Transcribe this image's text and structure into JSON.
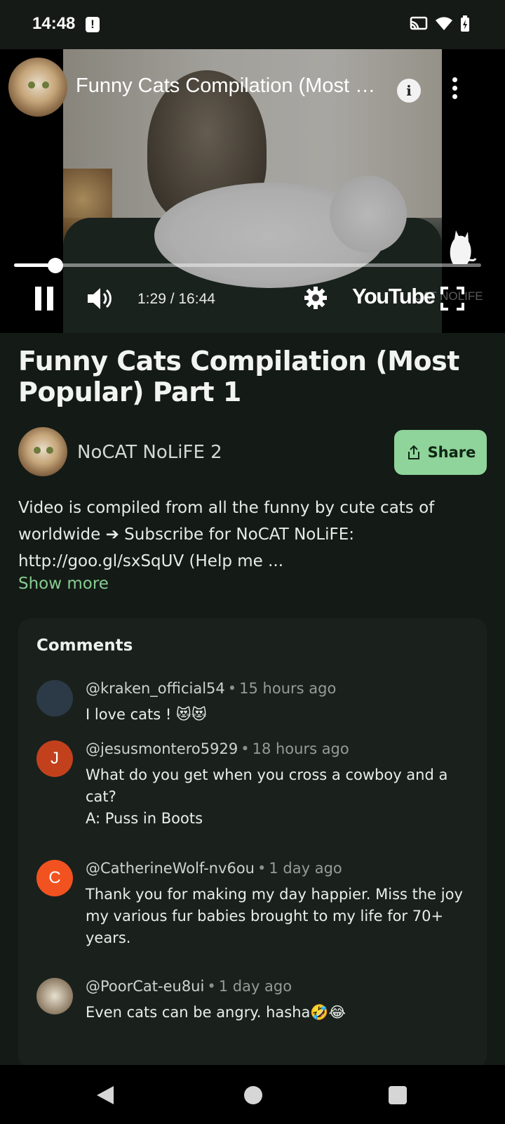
{
  "status_bar": {
    "time": "14:48",
    "alert_glyph": "!",
    "icons": [
      "cast-icon",
      "wifi-icon",
      "battery-charging-icon"
    ]
  },
  "player": {
    "title": "Funny Cats Compilation (Most Popular) Part 1",
    "info_glyph": "i",
    "time_readout": "1:29 / 16:44",
    "progress_fraction": 0.089,
    "logo_text": "YouTube",
    "watermark_text": "CAT NOLIFE"
  },
  "video": {
    "title": "Funny Cats Compilation (Most Popular) Part 1",
    "channel_name": "NoCAT NoLiFE 2",
    "share_label": "Share",
    "description": "Video is compiled from all the funny by cute cats of worldwide ➔ Subscribe for NoCAT NoLiFE: http://goo.gl/sxSqUV (Help me ...",
    "show_more_label": "Show more"
  },
  "comments": {
    "heading": "Comments",
    "items": [
      {
        "author": "@kraken_official54",
        "age": "15 hours ago",
        "lines": [
          "I love cats ! 😻😻"
        ],
        "avatar_letter": "",
        "avatar_color": "#2b3a46"
      },
      {
        "author": "@jesusmontero5929",
        "age": "18 hours ago",
        "lines": [
          "What do you get when you cross a cowboy and a cat?",
          "A: Puss in Boots"
        ],
        "avatar_letter": "J",
        "avatar_color": "#c2411c"
      },
      {
        "author": "@CatherineWolf-nv6ou",
        "age": "1 day ago",
        "lines": [
          "Thank you for making my day happier. Miss the joy my various fur babies brought to my life for 70+ years."
        ],
        "avatar_letter": "C",
        "avatar_color": "#f2521f"
      },
      {
        "author": "@PoorCat-eu8ui",
        "age": "1 day ago",
        "lines": [
          "Even cats can be angry. hasha🤣😂"
        ],
        "avatar_letter": "",
        "avatar_color": "#c7b8a2"
      }
    ]
  }
}
